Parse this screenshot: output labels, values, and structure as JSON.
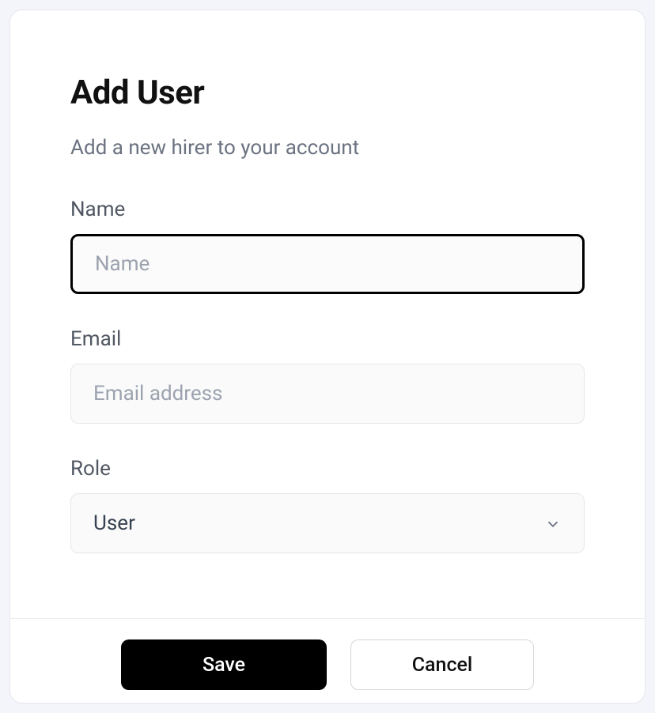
{
  "modal": {
    "title": "Add User",
    "subtitle": "Add a new hirer to your account"
  },
  "fields": {
    "name": {
      "label": "Name",
      "placeholder": "Name",
      "value": ""
    },
    "email": {
      "label": "Email",
      "placeholder": "Email address",
      "value": ""
    },
    "role": {
      "label": "Role",
      "selected": "User"
    }
  },
  "actions": {
    "save": "Save",
    "cancel": "Cancel"
  }
}
